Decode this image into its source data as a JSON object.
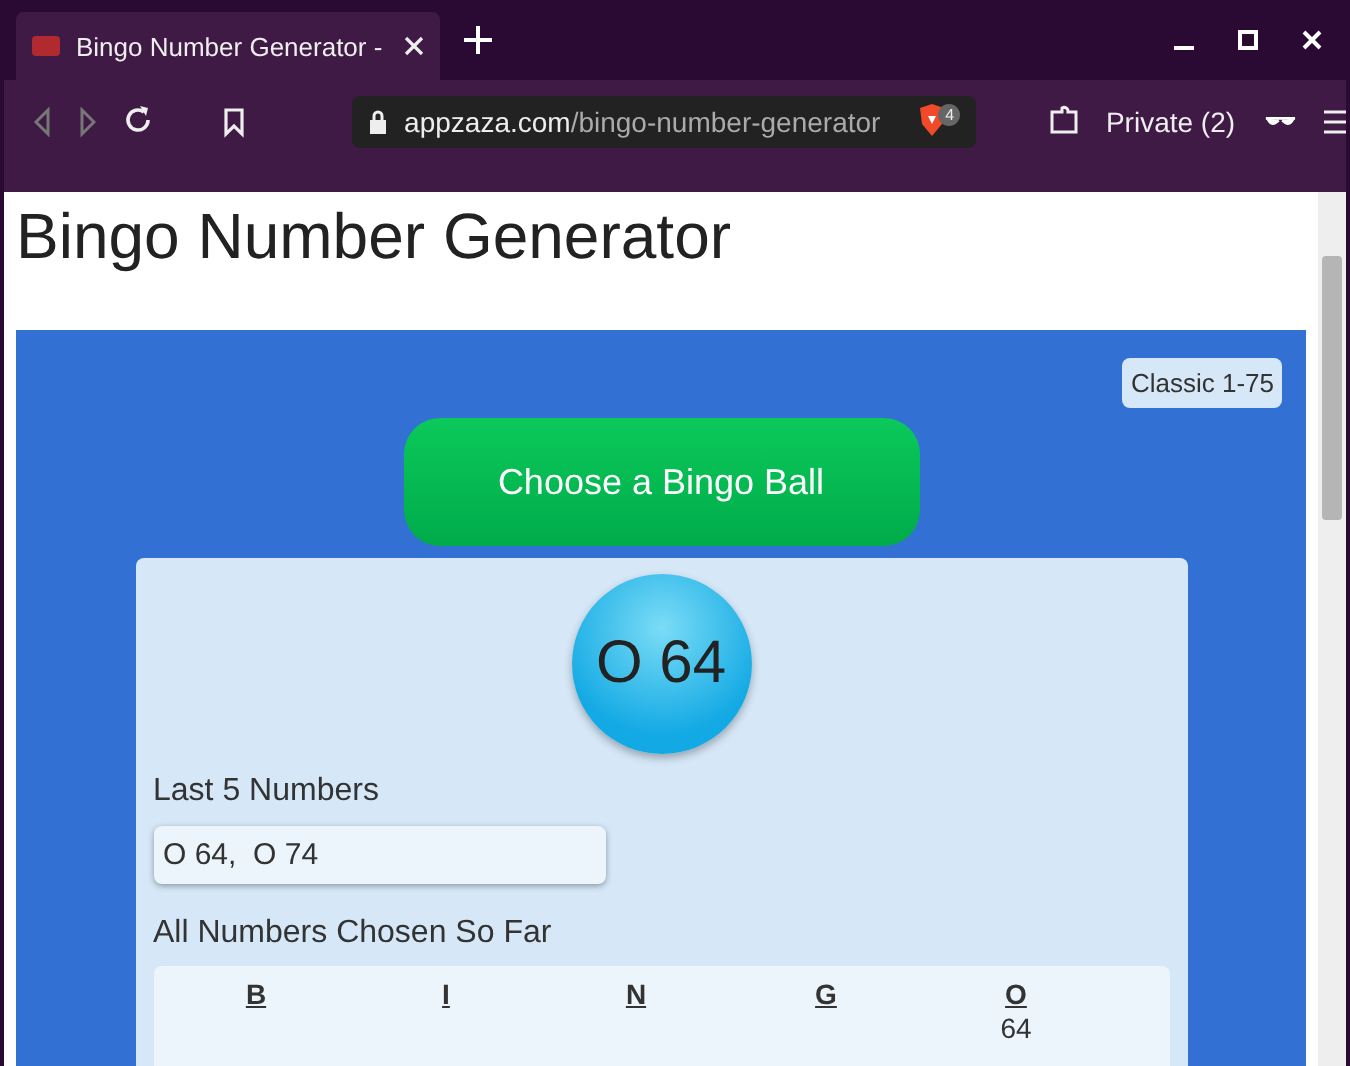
{
  "browser": {
    "tab_title": "Bingo Number Generator -",
    "address_domain": "appzaza.com",
    "address_path": "/bingo-number-generator",
    "shield_count": "4",
    "private_label": "Private (2)"
  },
  "page": {
    "title": "Bingo Number Generator",
    "mode_badge": "Classic 1-75",
    "choose_button": "Choose a Bingo Ball",
    "current_ball": "O 64",
    "last_label": "Last 5 Numbers",
    "last_numbers": "O 64,  O 74",
    "all_label": "All Numbers Chosen So Far",
    "columns": [
      {
        "letter": "B"
      },
      {
        "letter": "I"
      },
      {
        "letter": "N"
      },
      {
        "letter": "G"
      },
      {
        "letter": "O",
        "numbers": [
          "64"
        ]
      }
    ]
  }
}
